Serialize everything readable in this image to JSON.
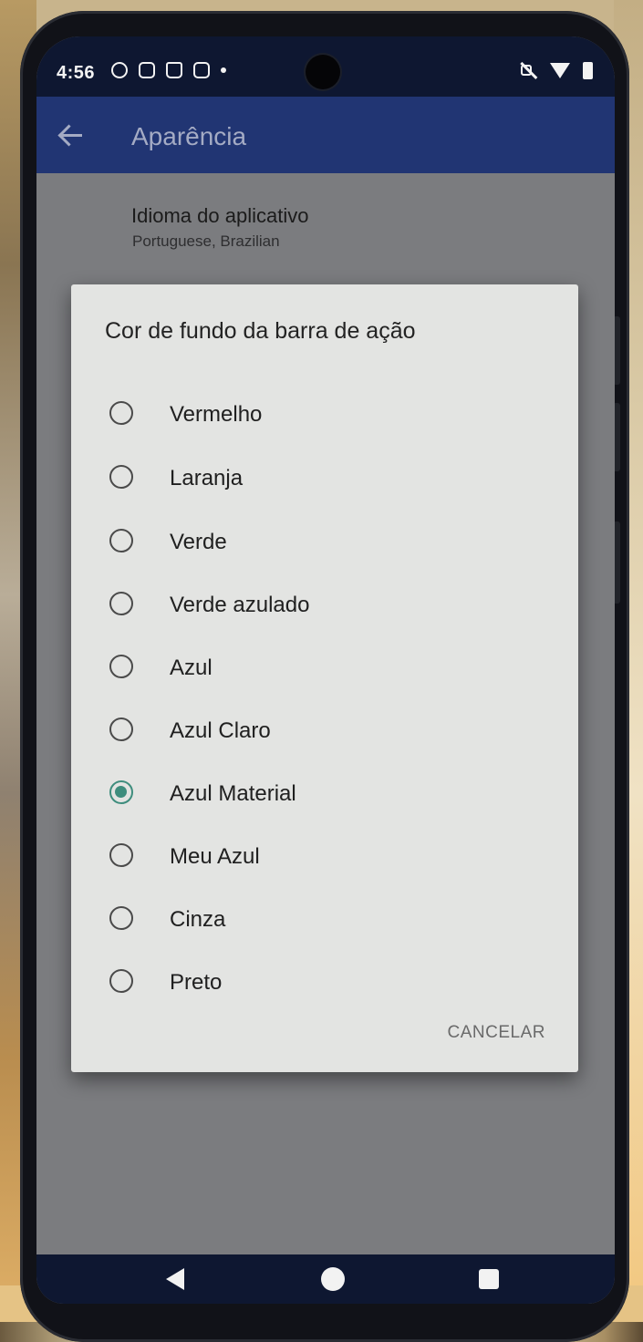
{
  "status_bar": {
    "time": "4:56",
    "left_icons": [
      "face-icon",
      "sim-card-icon",
      "bag-icon",
      "message-icon",
      "dot-icon"
    ],
    "right_icons": [
      "mute-icon",
      "wifi-icon",
      "battery-icon"
    ]
  },
  "toolbar": {
    "back_icon": "back-arrow-icon",
    "title": "Aparência",
    "background": "#213573"
  },
  "settings": {
    "items": [
      {
        "title": "Idioma do aplicativo",
        "subtitle": "Portuguese, Brazilian"
      }
    ]
  },
  "dialog": {
    "title": "Cor de fundo da barra de ação",
    "options": [
      {
        "label": "Vermelho",
        "selected": false
      },
      {
        "label": "Laranja",
        "selected": false
      },
      {
        "label": "Verde",
        "selected": false
      },
      {
        "label": "Verde azulado",
        "selected": false
      },
      {
        "label": "Azul",
        "selected": false
      },
      {
        "label": "Azul Claro",
        "selected": false
      },
      {
        "label": "Azul Material",
        "selected": true
      },
      {
        "label": "Meu Azul",
        "selected": false
      },
      {
        "label": "Cinza",
        "selected": false
      },
      {
        "label": "Preto",
        "selected": false
      }
    ],
    "cancel_label": "CANCELAR",
    "accent": "#3e8d7d"
  },
  "nav_bar": {
    "buttons": [
      "nav-back-icon",
      "nav-home-icon",
      "nav-recents-icon"
    ]
  }
}
